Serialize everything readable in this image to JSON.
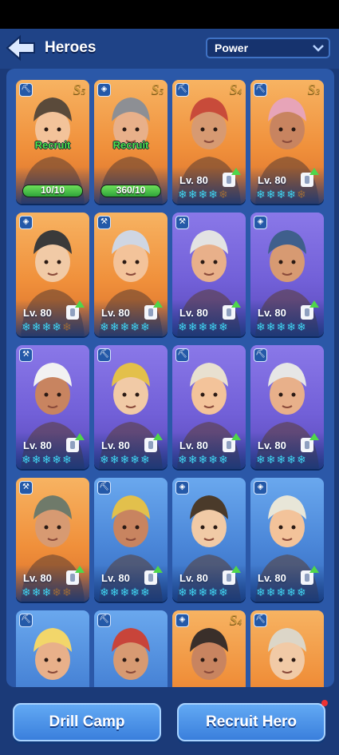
{
  "header": {
    "title": "Heroes",
    "sort_value": "Power"
  },
  "colors": {
    "background": "#1b3a78",
    "panel": "#2b58a8",
    "card_orange": "#f0903b",
    "card_purple": "#7260d8",
    "card_blue": "#4a86d8",
    "star_on": "#3fd2f0",
    "recruit_green": "#4fe24a"
  },
  "heroes": [
    {
      "class_icon": "pickaxe-icon",
      "tier": "S",
      "tier_num": "5",
      "frame": "orange",
      "recruit": "Recruit",
      "fragments": "10/10",
      "fragment_progress": 1.0
    },
    {
      "class_icon": "shield-icon",
      "tier": "S",
      "tier_num": "5",
      "frame": "orange",
      "recruit": "Recruit",
      "fragments": "360/10",
      "fragment_progress": 1.0
    },
    {
      "class_icon": "pickaxe-icon",
      "tier": "S",
      "tier_num": "4",
      "frame": "orange",
      "level": "Lv. 80",
      "stars": 4,
      "upgrade": true
    },
    {
      "class_icon": "pickaxe-icon",
      "tier": "S",
      "tier_num": "3",
      "frame": "orange",
      "level": "Lv. 80",
      "stars": 4,
      "upgrade": true
    },
    {
      "class_icon": "shield-icon",
      "frame": "orange",
      "level": "Lv. 80",
      "stars": 4,
      "upgrade": true
    },
    {
      "class_icon": "axe-icon",
      "frame": "orange",
      "level": "Lv. 80",
      "stars": 5,
      "upgrade": true
    },
    {
      "class_icon": "axe-icon",
      "frame": "purple",
      "level": "Lv. 80",
      "stars": 5,
      "upgrade": true
    },
    {
      "class_icon": "shield-icon",
      "frame": "purple",
      "level": "Lv. 80",
      "stars": 5,
      "upgrade": true
    },
    {
      "class_icon": "axe-icon",
      "frame": "purple",
      "level": "Lv. 80",
      "stars": 5,
      "upgrade": true
    },
    {
      "class_icon": "pickaxe-icon",
      "frame": "purple",
      "level": "Lv. 80",
      "stars": 5,
      "upgrade": true
    },
    {
      "class_icon": "pickaxe-icon",
      "frame": "purple",
      "level": "Lv. 80",
      "stars": 5,
      "upgrade": true
    },
    {
      "class_icon": "pickaxe-icon",
      "frame": "purple",
      "level": "Lv. 80",
      "stars": 5,
      "upgrade": true
    },
    {
      "class_icon": "axe-icon",
      "frame": "orange",
      "level": "Lv. 80",
      "stars": 3,
      "upgrade": true
    },
    {
      "class_icon": "pickaxe-icon",
      "frame": "blue",
      "level": "Lv. 80",
      "stars": 5,
      "upgrade": true
    },
    {
      "class_icon": "shield-icon",
      "frame": "blue",
      "level": "Lv. 80",
      "stars": 5,
      "upgrade": true
    },
    {
      "class_icon": "shield-icon",
      "frame": "blue",
      "level": "Lv. 80",
      "stars": 5,
      "upgrade": true
    },
    {
      "class_icon": "pickaxe-icon",
      "frame": "blue"
    },
    {
      "class_icon": "pickaxe-icon",
      "frame": "blue"
    },
    {
      "class_icon": "shield-icon",
      "tier": "S",
      "tier_num": "4",
      "frame": "orange"
    },
    {
      "class_icon": "pickaxe-icon",
      "frame": "orange"
    }
  ],
  "footer": {
    "left_button": "Drill Camp",
    "right_button": "Recruit Hero"
  }
}
